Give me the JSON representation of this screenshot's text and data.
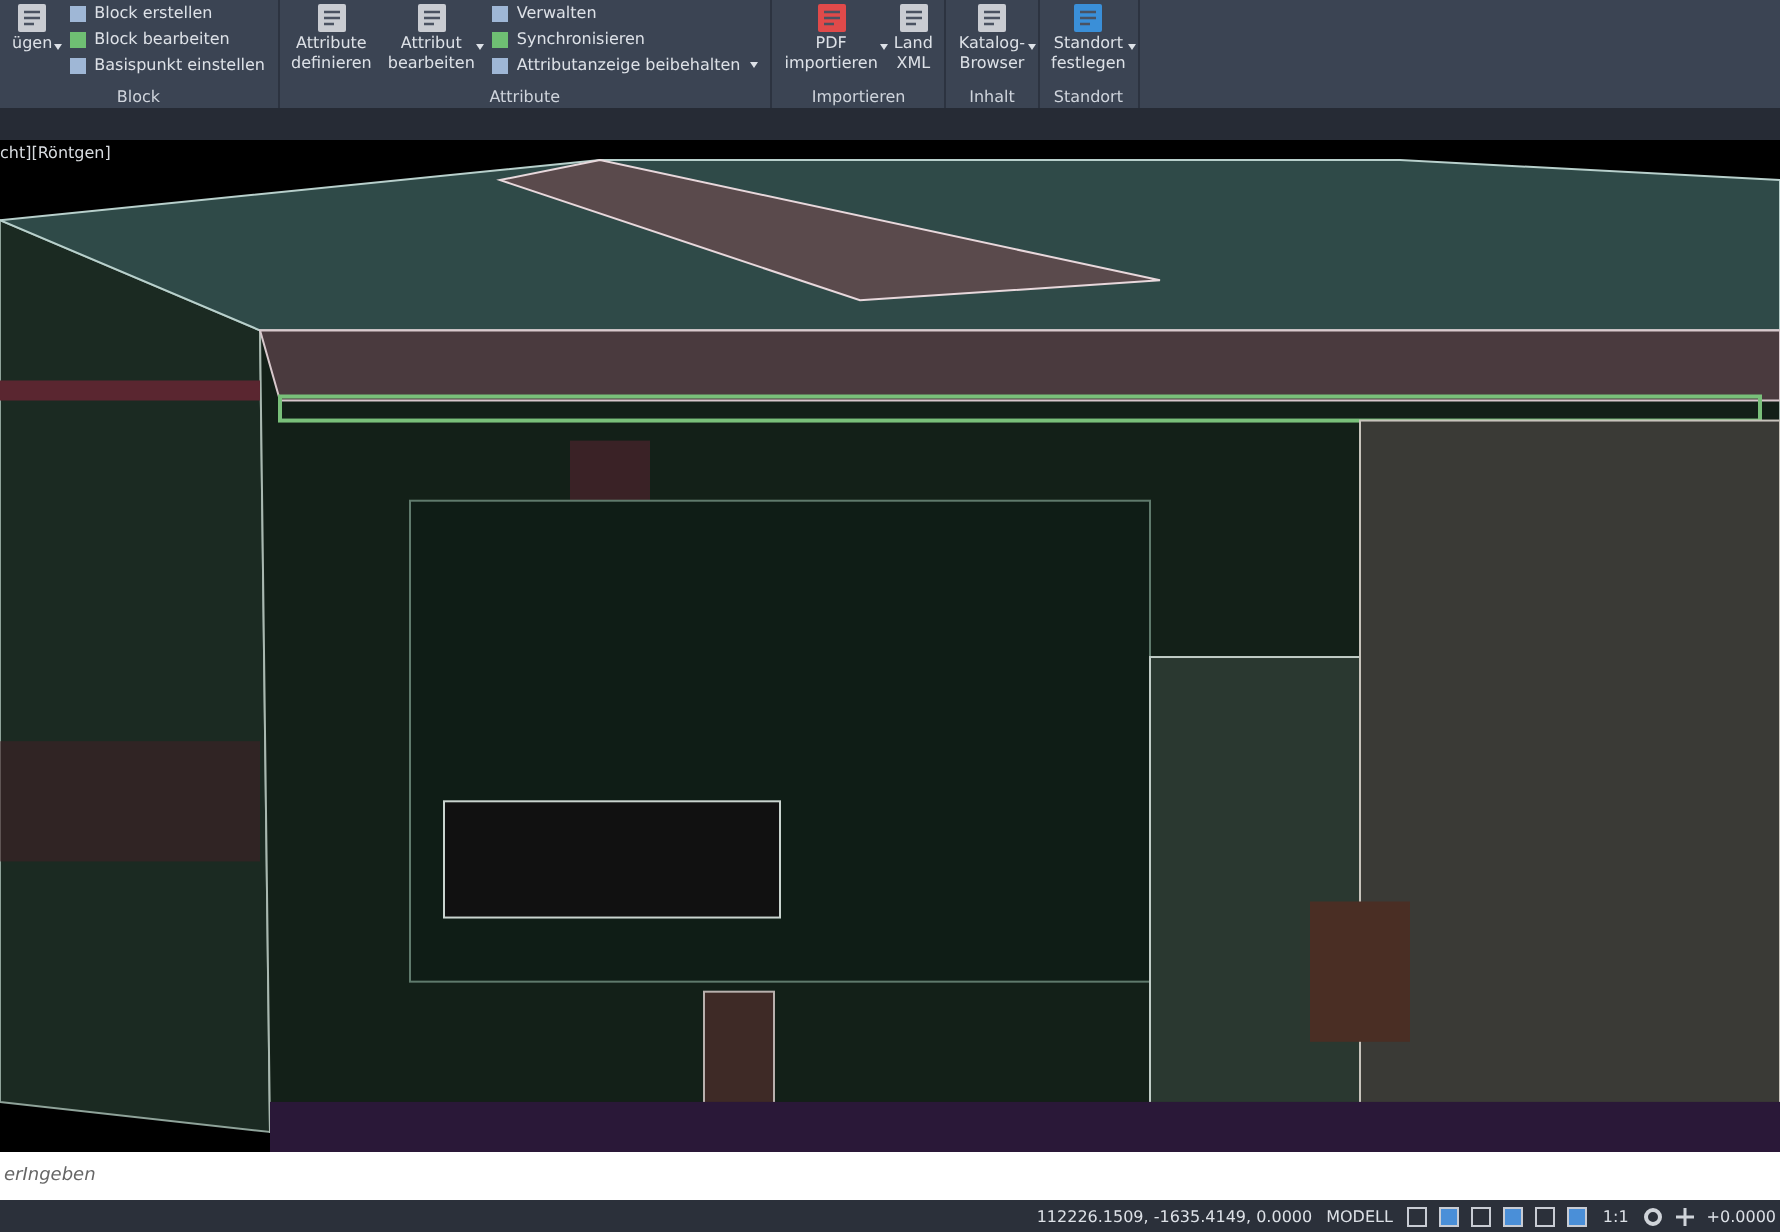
{
  "ribbon": {
    "groups": [
      {
        "label": "Block",
        "large": [
          {
            "lines": [
              "ügen"
            ],
            "has_menu": true
          }
        ],
        "small": [
          {
            "label": "Block erstellen",
            "has_menu": false
          },
          {
            "label": "Block bearbeiten",
            "has_menu": false
          },
          {
            "label": "Basispunkt einstellen",
            "has_menu": false
          }
        ]
      },
      {
        "label": "Attribute",
        "large": [
          {
            "lines": [
              "Attribute",
              "definieren"
            ],
            "has_menu": false
          },
          {
            "lines": [
              "Attribut",
              "bearbeiten"
            ],
            "has_menu": true
          }
        ],
        "small": [
          {
            "label": "Verwalten",
            "has_menu": false
          },
          {
            "label": "Synchronisieren",
            "has_menu": false
          },
          {
            "label": "Attributanzeige beibehalten",
            "has_menu": true
          }
        ]
      },
      {
        "label": "Importieren",
        "large": [
          {
            "lines": [
              "PDF",
              "importieren"
            ],
            "has_menu": true
          },
          {
            "lines": [
              "Land",
              "XML"
            ],
            "has_menu": false
          }
        ]
      },
      {
        "label": "Inhalt",
        "large": [
          {
            "lines": [
              "Katalog-",
              "Browser"
            ],
            "has_menu": true
          }
        ]
      },
      {
        "label": "Standort",
        "large": [
          {
            "lines": [
              "Standort",
              "festlegen"
            ],
            "has_menu": true
          }
        ]
      }
    ]
  },
  "viewport": {
    "label": "cht][Röntgen]"
  },
  "command_line": {
    "placeholder": "erIngeben"
  },
  "status_bar": {
    "coordinates": "112226.1509, -1635.4149, 0.0000",
    "space": "MODELL",
    "scale": "1:1",
    "value": "+0.0000"
  }
}
